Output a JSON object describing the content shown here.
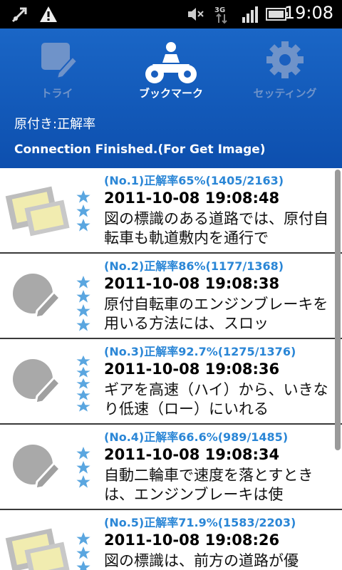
{
  "status_bar": {
    "time": "19:08",
    "icons": [
      "usb-debug-icon",
      "warning-icon",
      "mute-icon",
      "3g-icon",
      "signal-icon",
      "battery-icon"
    ]
  },
  "tabs": [
    {
      "label": "トライ",
      "icon": "pencil-note-icon",
      "active": false
    },
    {
      "label": "ブックマーク",
      "icon": "motorbike-icon",
      "active": true
    },
    {
      "label": "セッティング",
      "icon": "gear-icon",
      "active": false
    }
  ],
  "header": {
    "subtitle": "原付き:正解率",
    "connection_status": "Connection Finished.(For Get Image)"
  },
  "items": [
    {
      "rate": "(No.1)正解率65%(1405/2163)",
      "date": "2011-10-08 19:08:48",
      "text": "図の標識のある道路では、原付自転車も軌道敷内を通行で",
      "thumb": "sign-icon",
      "stars": 3
    },
    {
      "rate": "(No.2)正解率86%(1177/1368)",
      "date": "2011-10-08 19:08:38",
      "text": "原付自転車のエンジンブレーキを用いる方法には、スロッ",
      "thumb": "note-icon",
      "stars": 4
    },
    {
      "rate": "(No.3)正解率92.7%(1275/1376)",
      "date": "2011-10-08 19:08:36",
      "text": "ギアを高速（ハイ）から、いきなり低速（ロー）にいれる",
      "thumb": "note-icon",
      "stars": 5
    },
    {
      "rate": "(No.4)正解率66.6%(989/1485)",
      "date": "2011-10-08 19:08:34",
      "text": "自動二輪車で速度を落とすときは、エンジンブレーキは使",
      "thumb": "note-icon",
      "stars": 3
    },
    {
      "rate": "(No.5)正解率71.9%(1583/2203)",
      "date": "2011-10-08 19:08:26",
      "text": "図の標識は、前方の道路が優",
      "thumb": "sign-icon",
      "stars": 3
    }
  ],
  "colors": {
    "header_blue": "#1a5fbf",
    "rate_blue": "#2a86d6",
    "star_blue": "#5aa6e0",
    "inactive_tab": "#6f93c9"
  }
}
